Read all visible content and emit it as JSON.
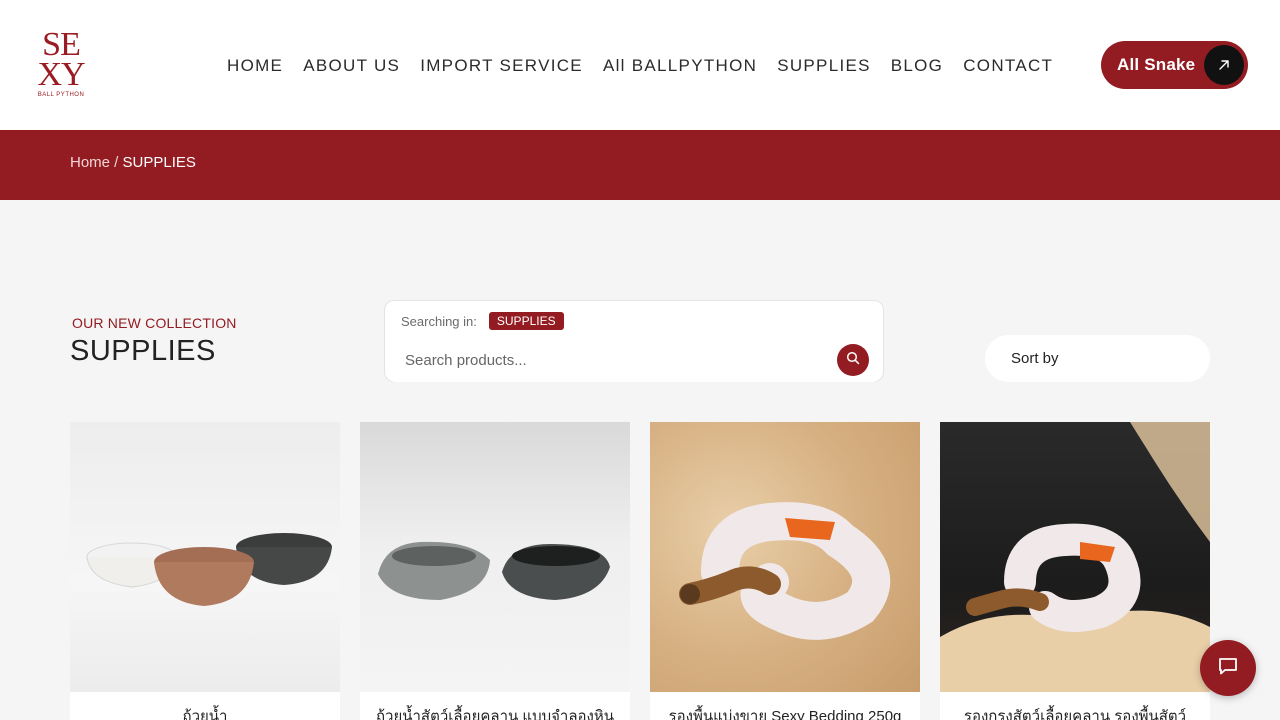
{
  "logo": {
    "line1": "SE",
    "line2": "XY",
    "tagline": "BALL PYTHON"
  },
  "nav": {
    "items": [
      {
        "label": "HOME"
      },
      {
        "label": "ABOUT US"
      },
      {
        "label": "IMPORT SERVICE"
      },
      {
        "label": "All BALLPYTHON"
      },
      {
        "label": "SUPPLIES"
      },
      {
        "label": "BLOG"
      },
      {
        "label": "CONTACT"
      }
    ]
  },
  "cta": {
    "label": "All Snake",
    "icon": "arrow-up-right-icon"
  },
  "breadcrumb": {
    "home": "Home",
    "separator": " / ",
    "current": "SUPPLIES"
  },
  "section": {
    "kicker": "OUR NEW COLLECTION",
    "title": "SUPPLIES"
  },
  "search": {
    "searching_label": "Searching in:",
    "scope_tag": "SUPPLIES",
    "placeholder": "Search products...",
    "value": "",
    "icon": "search-icon"
  },
  "sort": {
    "label": "Sort by"
  },
  "products": [
    {
      "name": "ถ้วยน้ำ"
    },
    {
      "name": "ถ้วยน้ำสัตว์เลื้อยคลาน แบบจำลองหิน"
    },
    {
      "name": "รองพื้นแบ่งขาย Sexy Bedding 250g"
    },
    {
      "name": "รองกรงสัตว์เลื้อยคลาน รองพื้นสัตว์"
    }
  ],
  "chat": {
    "icon": "chat-icon"
  },
  "colors": {
    "brand": "#931c22",
    "background": "#f5f5f5",
    "header": "#ffffff"
  }
}
